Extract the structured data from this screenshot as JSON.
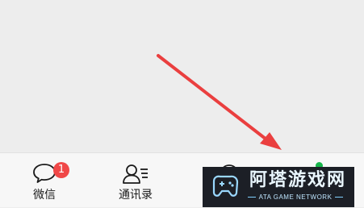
{
  "tab_bar": {
    "tabs": [
      {
        "label": "微信",
        "badge": "1"
      },
      {
        "label": "通讯录"
      },
      {
        "label": ""
      },
      {
        "label": ""
      }
    ]
  },
  "watermark": {
    "title": "阿塔游戏网",
    "subtitle": "ATA GAME NETWORK"
  },
  "colors": {
    "arrow": "#ea3f3f",
    "badge": "#f04848",
    "dot": "#16b54a"
  }
}
